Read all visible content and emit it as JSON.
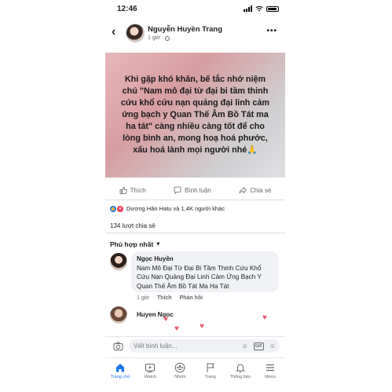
{
  "status_bar": {
    "time": "12:46"
  },
  "post": {
    "author": "Nguyễn Huyền Trang",
    "time": "1 giờ",
    "quote": "Khi gặp khó khăn, bế tắc nhớ niệm chú \"Nam mô đại từ đại bi tầm thinh cứu khổ cứu nạn quảng đại linh cảm ứng bạch y Quan Thế Âm Bồ Tát ma ha tát\" càng nhiều càng tốt để cho lòng bình an, mong hoạ hoá phước, xấu hoá lành mọi người nhé🙏",
    "colors": {
      "card_start": "#e7b7b9",
      "card_end": "#dfe0e2"
    }
  },
  "actions": {
    "like": "Thích",
    "comment": "Bình luận",
    "share": "Chia sẻ"
  },
  "reactions": {
    "text": "Dương Hân Hatu và 1,4K người khác"
  },
  "shares": {
    "text": "134 lượt chia sẻ"
  },
  "comments": {
    "filter_label": "Phù hợp nhất",
    "items": [
      {
        "name": "Ngọc Huyền",
        "text": "Nam Mô Đại Từ Đại Bi Tầm Thinh Cứu Khổ Cứu Nạn Quảng Đại Linh Cảm Ứng Bạch Y Quan Thế Âm Bồ Tát Ma Ha Tát",
        "time": "1 giờ",
        "like": "Thích",
        "reply": "Phản hồi"
      },
      {
        "name": "Huyen Ngoc"
      }
    ]
  },
  "composer": {
    "placeholder": "Viết bình luận..."
  },
  "tabbar": {
    "items": [
      {
        "label": "Trang chủ",
        "icon": "home-icon",
        "active": true
      },
      {
        "label": "Watch",
        "icon": "watch-icon"
      },
      {
        "label": "Nhóm",
        "icon": "groups-icon"
      },
      {
        "label": "Trang",
        "icon": "flag-icon"
      },
      {
        "label": "Thông báo",
        "icon": "bell-icon"
      },
      {
        "label": "Menu",
        "icon": "menu-icon"
      }
    ]
  },
  "accent_color": "#1877f2"
}
